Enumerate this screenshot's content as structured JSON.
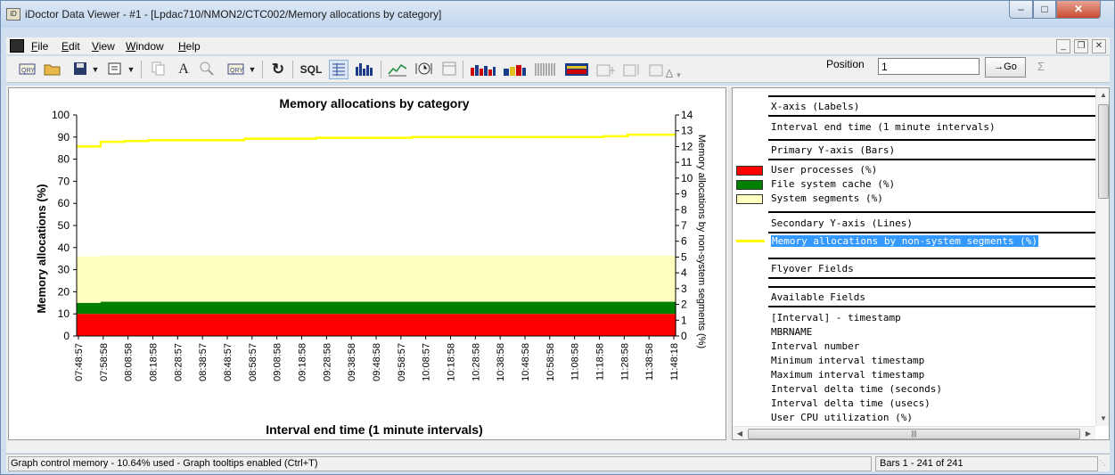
{
  "window": {
    "title": "iDoctor Data Viewer - #1 - [Lpdac710/NMON2/CTC002/Memory allocations by category]",
    "min_icon": "minimize-icon",
    "max_icon": "maximize-icon",
    "close_icon": "close-icon"
  },
  "menubar": {
    "items": [
      {
        "label": "File",
        "accel": "F"
      },
      {
        "label": "Edit",
        "accel": "E"
      },
      {
        "label": "View",
        "accel": "V"
      },
      {
        "label": "Window",
        "accel": "W"
      },
      {
        "label": "Help",
        "accel": "H"
      }
    ]
  },
  "toolbar": {
    "sql_label": "SQL",
    "font_label": "A",
    "position_label": "Position",
    "position_value": "1",
    "go_label": "→Go",
    "sigma_label": "Σ",
    "delta_label": "Δ"
  },
  "chart_data": {
    "type": "bar",
    "title": "Memory allocations by category",
    "xlabel": "Interval end time (1 minute intervals)",
    "ylabel": "Memory allocations (%)",
    "y2label": "Memory allocations by non-system segments (%)",
    "ylim": [
      0,
      100
    ],
    "y2lim": [
      0,
      14
    ],
    "yticks": [
      0,
      10,
      20,
      30,
      40,
      50,
      60,
      70,
      80,
      90,
      100
    ],
    "y2ticks": [
      0,
      1,
      2,
      3,
      4,
      5,
      6,
      7,
      8,
      9,
      10,
      11,
      12,
      13,
      14
    ],
    "categories": [
      "07:48:57",
      "07:58:58",
      "08:08:58",
      "08:18:58",
      "08:28:57",
      "08:38:57",
      "08:48:57",
      "08:58:57",
      "09:08:58",
      "09:18:58",
      "09:28:58",
      "09:38:58",
      "09:48:58",
      "09:58:57",
      "10:08:57",
      "10:18:58",
      "10:28:58",
      "10:38:58",
      "10:48:58",
      "10:58:58",
      "11:08:58",
      "11:18:58",
      "11:28:58",
      "11:38:58",
      "11:48:18"
    ],
    "series": [
      {
        "name": "User processes (%)",
        "color": "#ff0000",
        "values": [
          10,
          10,
          10,
          10,
          10,
          10,
          10,
          10,
          10,
          10,
          10,
          10,
          10,
          10,
          10,
          10,
          10,
          10,
          10,
          10,
          10,
          10,
          10,
          10,
          10
        ]
      },
      {
        "name": "File system cache (%)",
        "color": "#008000",
        "values": [
          5,
          5.5,
          5.5,
          5.5,
          5.5,
          5.5,
          5.5,
          5.5,
          5.5,
          5.5,
          5.5,
          5.5,
          5.5,
          5.5,
          5.5,
          5.5,
          5.5,
          5.5,
          5.5,
          5.5,
          5.5,
          5.5,
          5.5,
          5.5,
          5.5
        ]
      },
      {
        "name": "System segments (%)",
        "color": "#ffffc0",
        "values": [
          21,
          20.8,
          20.8,
          20.8,
          20.8,
          20.8,
          20.8,
          20.8,
          20.8,
          20.8,
          20.8,
          20.8,
          20.8,
          20.8,
          20.8,
          20.8,
          20.8,
          20.8,
          20.8,
          20.8,
          20.8,
          20.8,
          20.8,
          20.8,
          20.8
        ]
      }
    ],
    "line_series": [
      {
        "name": "Memory allocations by non-system segments (%)",
        "color": "#ffff00",
        "axis": "secondary",
        "values": [
          12.0,
          12.3,
          12.35,
          12.4,
          12.4,
          12.4,
          12.4,
          12.5,
          12.5,
          12.5,
          12.55,
          12.55,
          12.55,
          12.55,
          12.6,
          12.6,
          12.6,
          12.6,
          12.6,
          12.6,
          12.6,
          12.6,
          12.65,
          12.75,
          12.75
        ]
      }
    ],
    "grid": false,
    "legend": "right-panel"
  },
  "field_list": {
    "xaxis_header": "X-axis (Labels)",
    "xaxis_field": "Interval end time (1 minute intervals)",
    "primary_header": "Primary Y-axis (Bars)",
    "primary_fields": [
      {
        "label": "User processes (%)",
        "color": "#ff0000"
      },
      {
        "label": "File system cache (%)",
        "color": "#008000"
      },
      {
        "label": "System segments (%)",
        "color": "#ffffc0"
      }
    ],
    "secondary_header": "Secondary Y-axis (Lines)",
    "secondary_field": "Memory allocations by non-system segments (%)",
    "flyover_header": "Flyover Fields",
    "available_header": "Available Fields",
    "available_fields": [
      "[Interval] - timestamp",
      "MBRNAME",
      "Interval number",
      "Minimum interval timestamp",
      "Maximum interval timestamp",
      "Interval delta time (seconds)",
      "Interval delta time (usecs)",
      "User CPU utilization (%)"
    ]
  },
  "statusbar": {
    "left": "Graph control memory - 10.64% used - Graph tooltips enabled (Ctrl+T)",
    "right": "Bars 1 - 241 of 241"
  }
}
